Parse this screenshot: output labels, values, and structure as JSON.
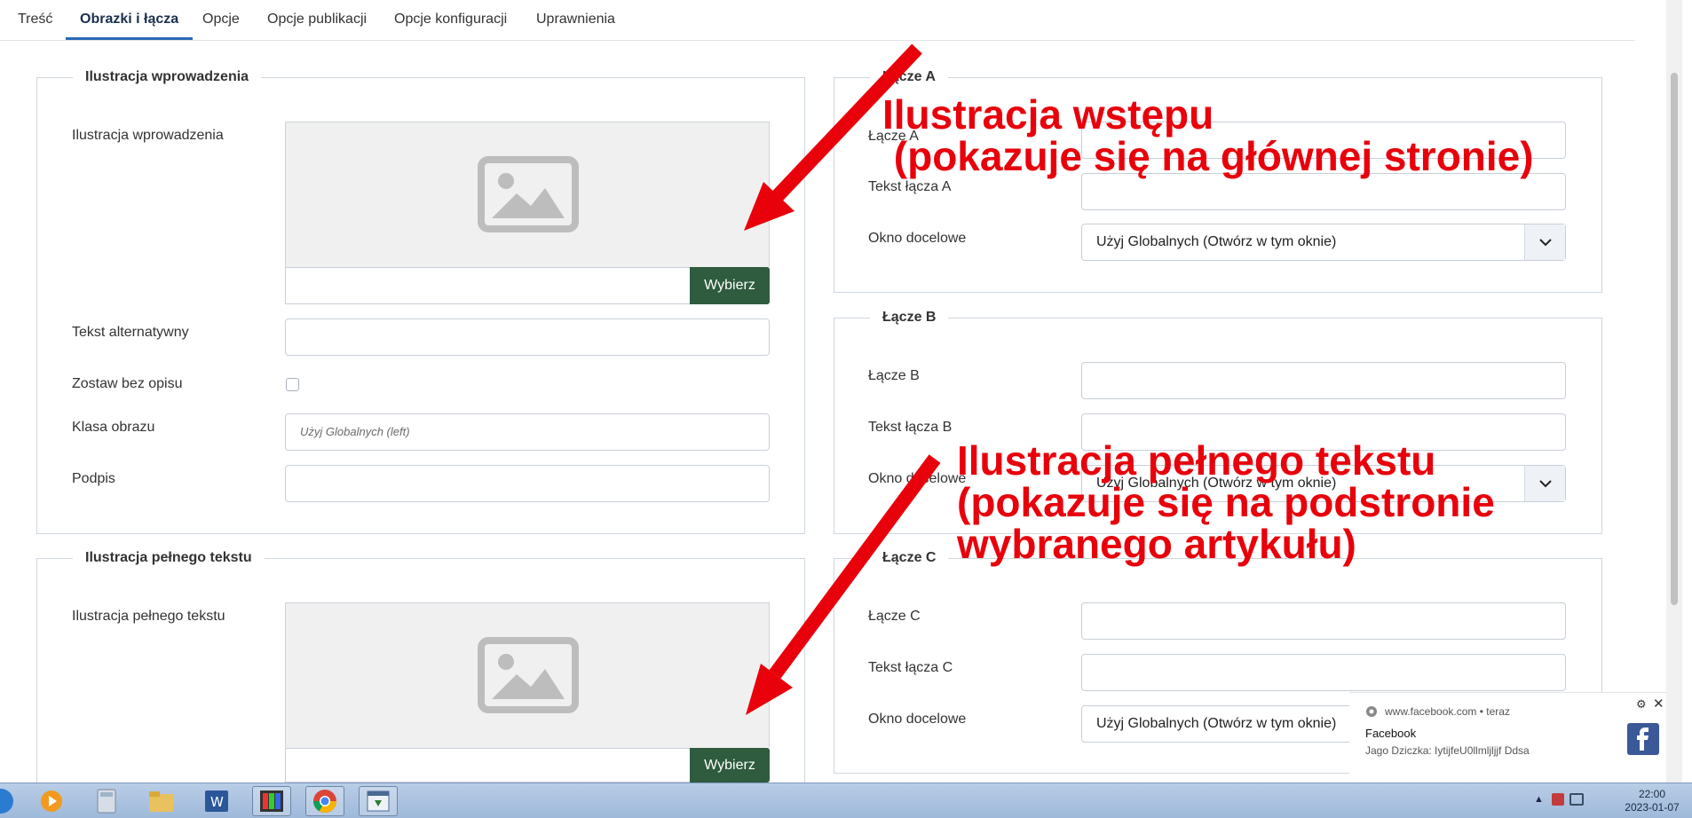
{
  "tabs": [
    "Treść",
    "Obrazki i łącza",
    "Opcje",
    "Opcje publikacji",
    "Opcje konfiguracji",
    "Uprawnienia"
  ],
  "active_tab": "Obrazki i łącza",
  "intro_image": {
    "legend": "Ilustracja wprowadzenia",
    "image_label": "Ilustracja wprowadzenia",
    "select_button": "Wybierz",
    "alt_label": "Tekst alternatywny",
    "no_desc_label": "Zostaw bez opisu",
    "class_label": "Klasa obrazu",
    "class_placeholder": "Użyj Globalnych (left)",
    "caption_label": "Podpis"
  },
  "full_image": {
    "legend": "Ilustracja pełnego tekstu",
    "image_label": "Ilustracja pełnego tekstu",
    "select_button": "Wybierz"
  },
  "link_a": {
    "legend": "Łącze A",
    "link_label": "Łącze A",
    "text_label": "Tekst łącza A",
    "target_label": "Okno docelowe",
    "target_value": "Użyj Globalnych (Otwórz w tym oknie)"
  },
  "link_b": {
    "legend": "Łącze B",
    "link_label": "Łącze B",
    "text_label": "Tekst łącza B",
    "target_label": "Okno docelowe",
    "target_value": "Użyj Globalnych (Otwórz w tym oknie)"
  },
  "link_c": {
    "legend": "Łącze C",
    "link_label": "Łącze C",
    "text_label": "Tekst łącza C",
    "target_label": "Okno docelowe",
    "target_value": "Użyj Globalnych (Otwórz w tym oknie)"
  },
  "annotations": {
    "intro": "Ilustracja wstępu\n (pokazuje się na głównej stronie)",
    "full": "Ilustracja pełnego tekstu\n(pokazuje się na podstronie\nwybranego artykułu)",
    "color": "#e8000b"
  },
  "notification": {
    "source": "www.facebook.com",
    "time": "teraz",
    "title": "Facebook",
    "body": "Jago Dziczka: IytijfeU0llmljljjf Ddsa"
  },
  "taskbar": {
    "time": "22:00",
    "date": "2023-01-07"
  },
  "colors": {
    "select_button": "#2f5b3e",
    "active_tab_underline": "#2a69b8"
  }
}
